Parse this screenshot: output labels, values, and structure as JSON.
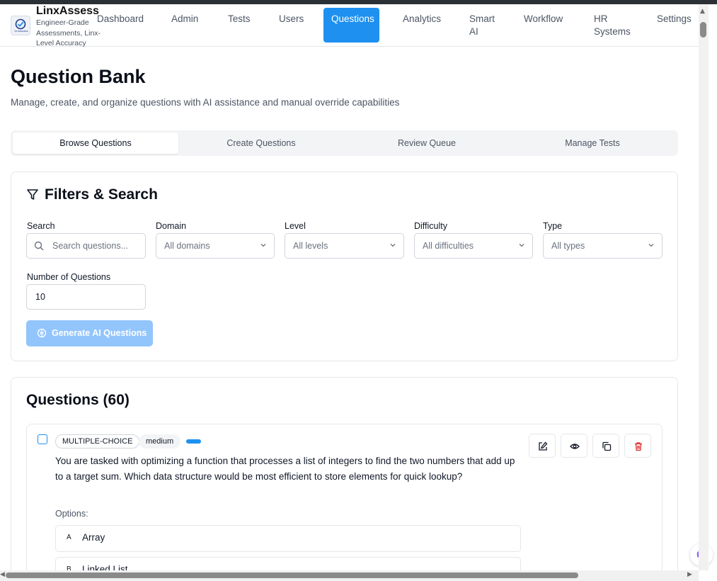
{
  "header": {
    "brand": "LinxAssess",
    "brand_subtitle": "Engineer-Grade Assessments, Linx-Level Accuracy",
    "logo_text": "LinxAssess",
    "nav": [
      {
        "label": "Dashboard"
      },
      {
        "label": "Admin"
      },
      {
        "label": "Tests"
      },
      {
        "label": "Users"
      },
      {
        "label": "Questions",
        "active": true
      },
      {
        "label": "Analytics"
      },
      {
        "label": "Smart AI"
      },
      {
        "label": "Workflow"
      },
      {
        "label": "HR Systems"
      },
      {
        "label": "Settings"
      }
    ]
  },
  "page": {
    "title": "Question Bank",
    "subtitle": "Manage, create, and organize questions with AI assistance and manual override capabilities"
  },
  "tabs": [
    {
      "label": "Browse Questions",
      "active": true
    },
    {
      "label": "Create Questions"
    },
    {
      "label": "Review Queue"
    },
    {
      "label": "Manage Tests"
    }
  ],
  "filters": {
    "title": "Filters & Search",
    "search_label": "Search",
    "search_placeholder": "Search questions...",
    "domain_label": "Domain",
    "domain_value": "All domains",
    "level_label": "Level",
    "level_value": "All levels",
    "difficulty_label": "Difficulty",
    "difficulty_value": "All difficulties",
    "type_label": "Type",
    "type_value": "All types",
    "count_label": "Number of Questions",
    "count_value": "10",
    "generate_label": "Generate AI Questions"
  },
  "questions": {
    "title": "Questions (60)",
    "items": [
      {
        "type_badge": "MULTIPLE-CHOICE",
        "difficulty_badge": "medium",
        "text": "You are tasked with optimizing a function that processes a list of integers to find the two numbers that add up to a target sum. Which data structure would be most efficient to store elements for quick lookup?",
        "options_label": "Options:",
        "options": [
          {
            "letter": "A",
            "text": "Array"
          },
          {
            "letter": "B",
            "text": "Linked List"
          }
        ]
      }
    ]
  },
  "colors": {
    "primary": "#1e90f0",
    "primary_disabled": "#93c5fd",
    "danger": "#dc2626",
    "border": "#e5e7eb"
  }
}
